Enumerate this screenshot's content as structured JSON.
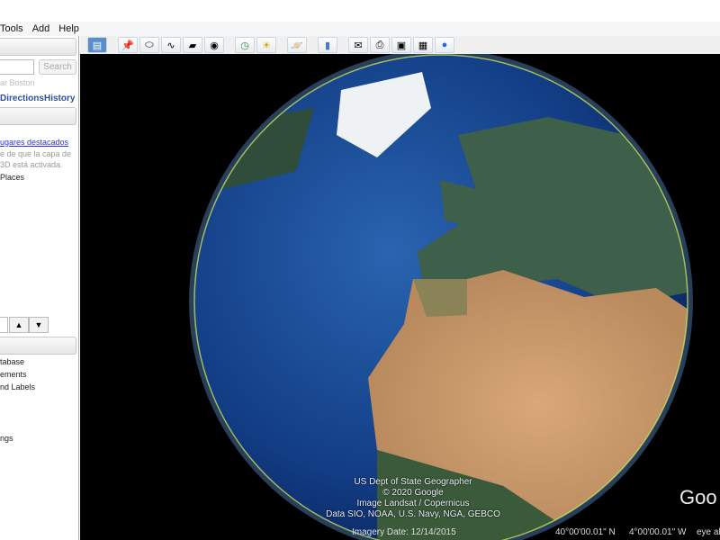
{
  "menu": [
    "Tools",
    "Add",
    "Help"
  ],
  "search": {
    "button": "Search",
    "hint": "ar Boston",
    "tabs": [
      "Directions",
      "History"
    ]
  },
  "places": {
    "link": "ugares destacados",
    "note1": "e de que la capa de",
    "note2": "3D está activada.",
    "item": "Places"
  },
  "layers": [
    "tabase",
    "ements",
    "nd Labels",
    "ngs"
  ],
  "toolbar": [
    "sidebar",
    "placemark",
    "polygon",
    "path",
    "image-overlay",
    "record-tour",
    "historical-imagery",
    "sun",
    "planets",
    "ruler",
    "email",
    "print",
    "save-image",
    "view-in-maps",
    "earth"
  ],
  "attribution": [
    "US Dept of State Geographer",
    "© 2020 Google",
    "Image Landsat / Copernicus",
    "Data SIO, NOAA, U.S. Navy, NGA, GEBCO"
  ],
  "status": {
    "imagery": "Imagery Date: 12/14/2015",
    "lat": "40°00'00.01\" N",
    "lon": "4°00'00.01\" W",
    "eye": "eye alt"
  },
  "logo": "Goo"
}
